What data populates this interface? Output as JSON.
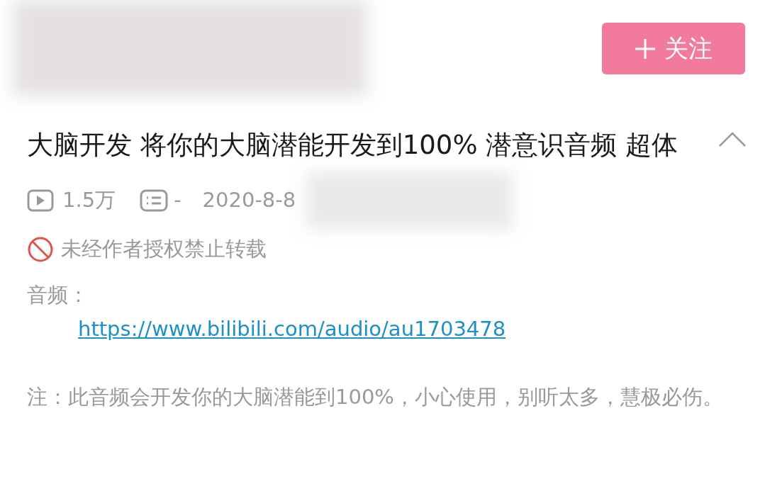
{
  "follow_button": {
    "label": "关注"
  },
  "video": {
    "title": "大脑开发 将你的大脑潜能开发到100% 潜意识音频 超体",
    "expanded": true,
    "stats": {
      "plays": "1.5万",
      "danmaku": "-",
      "date": "2020-8-8"
    },
    "copyright_notice": "未经作者授权禁止转载",
    "description": [
      {
        "kind": "text",
        "text": "音频："
      },
      {
        "kind": "link",
        "text": "https://www.bilibili.com/audio/au1703478"
      },
      {
        "kind": "text",
        "text": "注：此音频会开发你的大脑潜能到100%，小心使用，别听太多，慧极必伤。"
      }
    ]
  }
}
